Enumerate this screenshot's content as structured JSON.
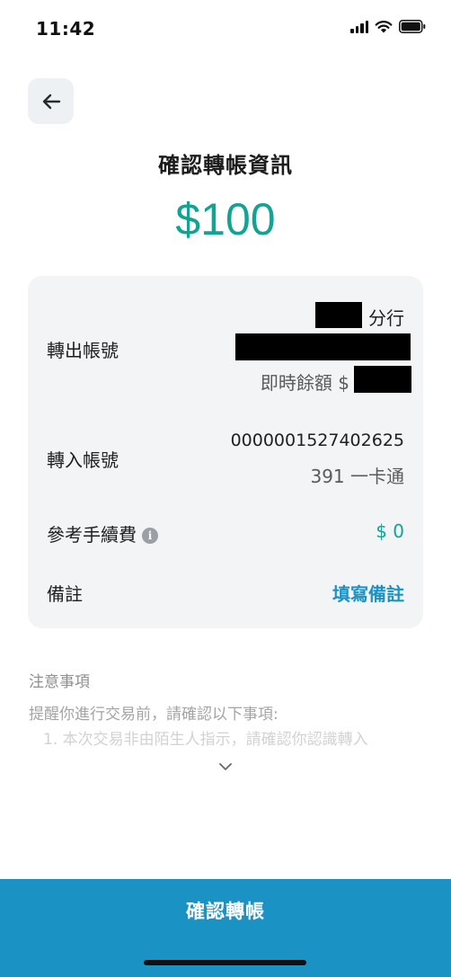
{
  "status": {
    "time": "11:42"
  },
  "page": {
    "title": "確認轉帳資訊",
    "amount": "$100"
  },
  "transfer": {
    "from_label": "轉出帳號",
    "from_branch_suffix": "分行",
    "from_balance_prefix": "即時餘額 $",
    "to_label": "轉入帳號",
    "to_account": "0000001527402625",
    "to_bank": "391 一卡通",
    "fee_label": "參考手續費",
    "fee_value": "$ 0",
    "memo_label": "備註",
    "memo_action": "填寫備註"
  },
  "notice": {
    "title": "注意事項",
    "text": "提醒你進行交易前，請確認以下事項:",
    "item1": "1. 本次交易非由陌生人指示，請確認你認識轉入"
  },
  "footer": {
    "confirm_label": "確認轉帳"
  },
  "colors": {
    "accent": "#13a393",
    "primary_button": "#1a93c4",
    "link": "#1a93c4",
    "card_bg": "#f2f4f6"
  },
  "icons": [
    "back-arrow-icon",
    "info-icon",
    "chevron-down-icon",
    "signal-icon",
    "wifi-icon",
    "battery-icon"
  ]
}
